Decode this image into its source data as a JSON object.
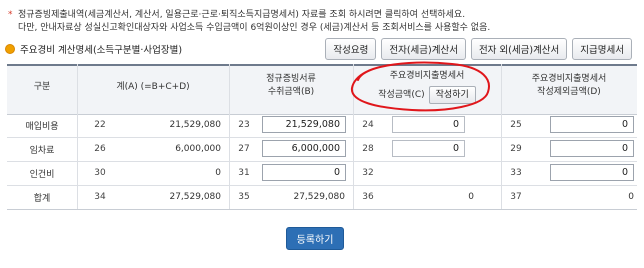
{
  "notice": {
    "line1": "정규증빙제출내역(세금계산서, 계산서, 일용근로·근로·퇴직소득지급명세서) 자료를 조회 하시려면 클릭하여 선택하세요.",
    "line2": "다만, 안내자료상 성실신고확인대상자와 사업소득 수입금액이 6억원이상인 경우 (세금)계산서 등 조회서비스를 사용할수 없음."
  },
  "section_title": "주요경비 계산명세(소득구분별·사업장별)",
  "buttons": {
    "guide": "작성요령",
    "e_invoice": "전자(세금)계산서",
    "non_e_invoice": "전자 외(세금)계산서",
    "payment_statement": "지급명세서"
  },
  "headers": {
    "category": "구분",
    "total": "계(A) (=B+C+D)",
    "formal_l1": "정규증빙서류",
    "formal_l2": "수취금액(B)",
    "main_l1": "주요경비지출명세서",
    "main_l2": "작성금액(C)",
    "write_button": "작성하기",
    "outside_l1": "주요경비지출명세서",
    "outside_l2": "작성제외금액(D)"
  },
  "rows": [
    {
      "label": "매입비용",
      "c1": "22",
      "total": "21,529,080",
      "c2": "23",
      "formal": "21,529,080",
      "c3": "24",
      "main": "0",
      "c4": "25",
      "outside": "0"
    },
    {
      "label": "임차료",
      "c1": "26",
      "total": "6,000,000",
      "c2": "27",
      "formal": "6,000,000",
      "c3": "28",
      "main": "0",
      "c4": "29",
      "outside": "0"
    },
    {
      "label": "인건비",
      "c1": "30",
      "total": "0",
      "c2": "31",
      "formal": "0",
      "c3": "32",
      "main": "",
      "c4": "33",
      "outside": "0"
    },
    {
      "label": "합계",
      "c1": "34",
      "total": "27,529,080",
      "c2": "35",
      "formal": "27,529,080",
      "c3": "36",
      "main": "0",
      "c4": "37",
      "outside": "0"
    }
  ],
  "submit_label": "등록하기",
  "colors": {
    "annotation_red": "#e0161b",
    "primary_blue": "#2d6fb5",
    "header_bg": "#f2f4f7"
  }
}
